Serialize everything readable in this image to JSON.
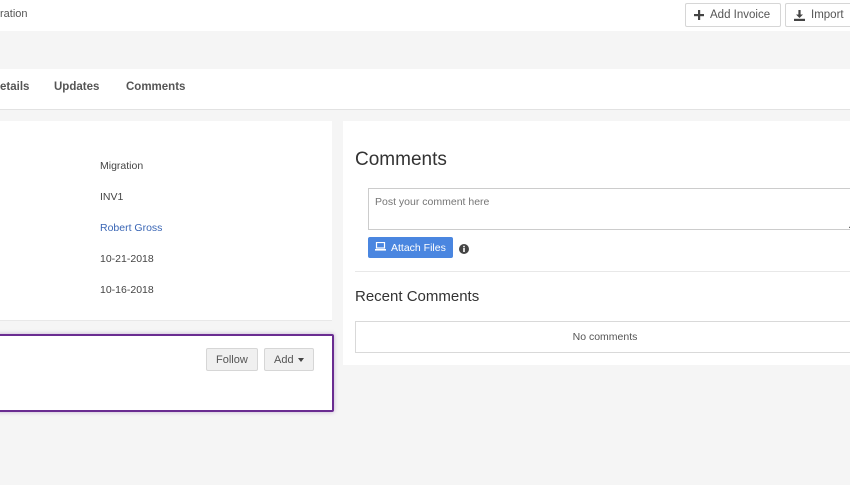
{
  "header": {
    "breadcrumb_text": "ration",
    "add_invoice_label": "Add Invoice",
    "import_label": "Import"
  },
  "tabs": [
    {
      "label": "etails"
    },
    {
      "label": "Updates"
    },
    {
      "label": "Comments"
    }
  ],
  "details": {
    "values": [
      "Migration",
      "INV1",
      "Robert Gross",
      "10-21-2018",
      "10-16-2018"
    ]
  },
  "follow_panel": {
    "follow_label": "Follow",
    "add_label": "Add"
  },
  "comments": {
    "title": "Comments",
    "placeholder": "Post your comment here",
    "attach_label": "Attach Files",
    "recent_title": "Recent Comments",
    "empty_text": "No comments"
  },
  "colors": {
    "accent_blue": "#4a86e0",
    "link_blue": "#3a66b5",
    "highlight_purple": "#6a2c91"
  }
}
